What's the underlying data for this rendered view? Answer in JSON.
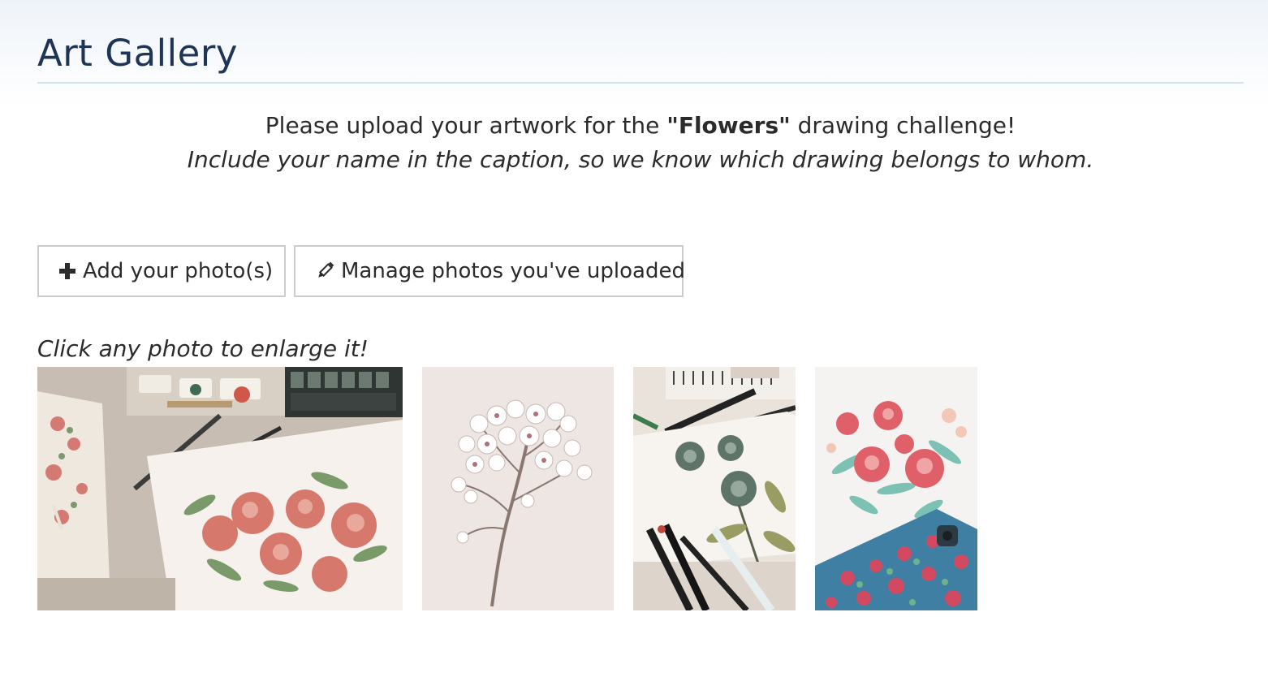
{
  "page": {
    "title": "Art Gallery"
  },
  "intro": {
    "prefix": "Please upload your artwork for the ",
    "challenge_name": "\"Flowers\"",
    "suffix": " drawing challenge!",
    "line2": "Include your name in the caption, so we know which drawing belongs to whom."
  },
  "actions": {
    "add_label": "Add your photo(s)",
    "add_icon": "plus-icon",
    "manage_label": "Manage photos you've uploaded",
    "manage_icon": "pencil-icon"
  },
  "gallery": {
    "hint": "Click any photo to enlarge it!",
    "photos": [
      {
        "subject": "watercolor pink flowers with brushes and paint palette"
      },
      {
        "subject": "white cherry blossom branch drawing"
      },
      {
        "subject": "ink sketch of flowers with leaves and pens"
      },
      {
        "subject": "red poppies watercolor with floral phone case"
      }
    ]
  },
  "colors": {
    "title": "#1e3556",
    "text": "#2b2b2b",
    "border": "#cccccc",
    "rule": "#d5e3ee"
  }
}
